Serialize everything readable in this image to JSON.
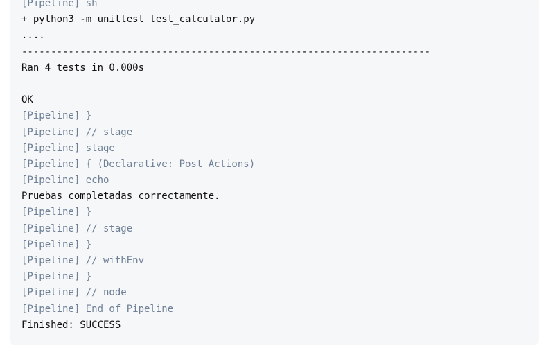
{
  "console": {
    "lines": [
      {
        "type": "pipeline",
        "text": "[Pipeline] sh"
      },
      {
        "type": "output",
        "text": "+ python3 -m unittest test_calculator.py"
      },
      {
        "type": "output",
        "text": "...."
      },
      {
        "type": "output",
        "text": "----------------------------------------------------------------------"
      },
      {
        "type": "output",
        "text": "Ran 4 tests in 0.000s"
      },
      {
        "type": "blank",
        "text": ""
      },
      {
        "type": "output",
        "text": "OK"
      },
      {
        "type": "pipeline",
        "text": "[Pipeline] }"
      },
      {
        "type": "pipeline",
        "text": "[Pipeline] // stage"
      },
      {
        "type": "pipeline",
        "text": "[Pipeline] stage"
      },
      {
        "type": "pipeline",
        "text": "[Pipeline] { (Declarative: Post Actions)"
      },
      {
        "type": "pipeline",
        "text": "[Pipeline] echo"
      },
      {
        "type": "output",
        "text": "Pruebas completadas correctamente."
      },
      {
        "type": "pipeline",
        "text": "[Pipeline] }"
      },
      {
        "type": "pipeline",
        "text": "[Pipeline] // stage"
      },
      {
        "type": "pipeline",
        "text": "[Pipeline] }"
      },
      {
        "type": "pipeline",
        "text": "[Pipeline] // withEnv"
      },
      {
        "type": "pipeline",
        "text": "[Pipeline] }"
      },
      {
        "type": "pipeline",
        "text": "[Pipeline] // node"
      },
      {
        "type": "pipeline",
        "text": "[Pipeline] End of Pipeline"
      },
      {
        "type": "output",
        "text": "Finished: SUCCESS"
      }
    ]
  }
}
